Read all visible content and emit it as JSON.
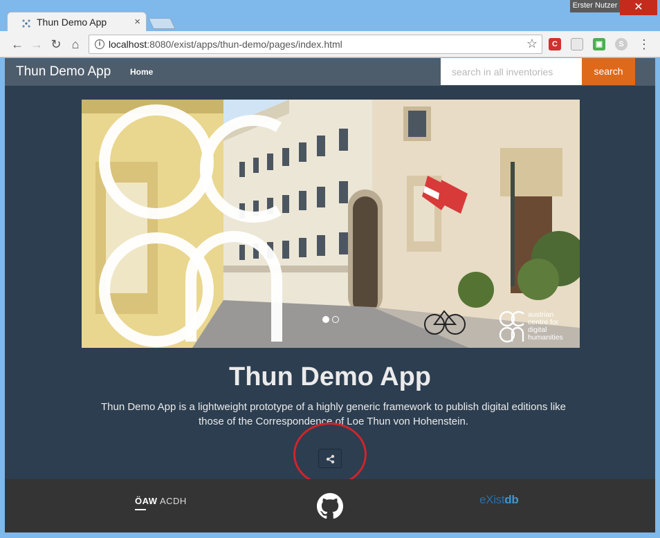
{
  "browser": {
    "tab_title": "Thun Demo App",
    "tab_close": "×",
    "window_user": "Erster Nutzer",
    "url_host": "localhost",
    "url_rest": ":8080/exist/apps/thun-demo/pages/index.html"
  },
  "navbar": {
    "brand": "Thun Demo App",
    "home": "Home",
    "search_placeholder": "search in all inventories",
    "search_button": "search"
  },
  "hero": {
    "logo_lines": [
      "austrian",
      "centre for",
      "digital",
      "humanities"
    ],
    "slides": 2,
    "active_slide": 1
  },
  "main": {
    "title": "Thun Demo App",
    "description": "Thun Demo App is a lightweight prototype of a highly generic framework to publish digital editions like those of the Correspondence of Loe Thun von Hohenstein."
  },
  "footer": {
    "oaw_strong": "ÖAW",
    "oaw_thin": "ACDH",
    "existdb_prefix": "eXist",
    "existdb_suffix": "db"
  },
  "colors": {
    "page_bg": "#2c3e50",
    "navbar_bg": "#4e5d6c",
    "accent": "#df691a",
    "footer_bg": "#343434",
    "highlight": "#d2232a"
  }
}
